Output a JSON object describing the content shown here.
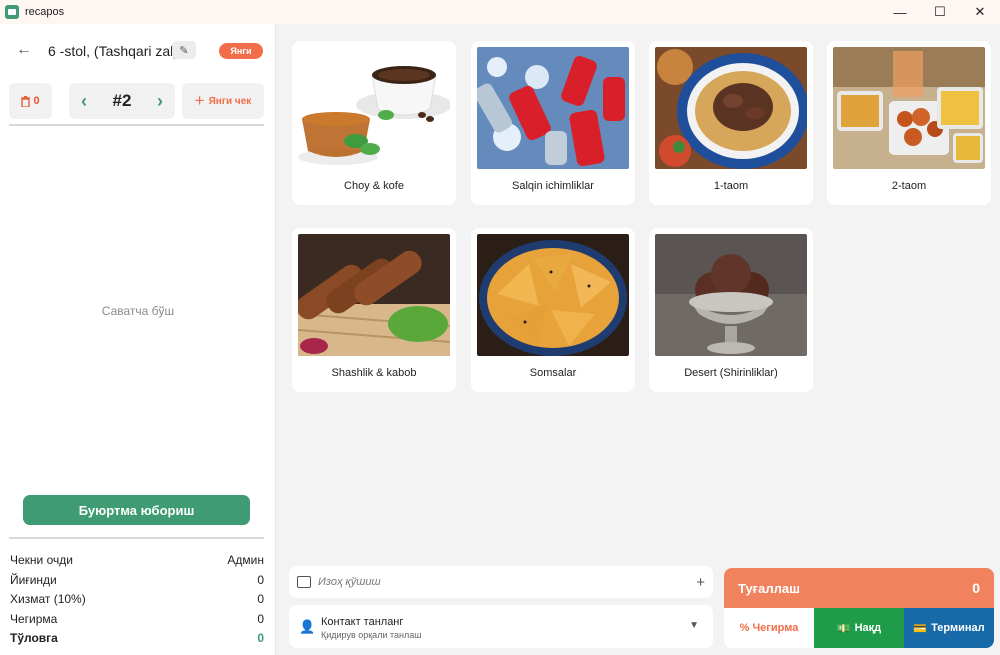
{
  "window": {
    "title": "recapos",
    "minimize": "—",
    "maximize": "☐",
    "close": "✕"
  },
  "order": {
    "table_name": "6 -stol, (Tashqari zal)",
    "status_badge": "Янги",
    "trash_count": "0",
    "check_number": "#2",
    "new_check_label": "Янги чек",
    "cart_empty": "Саватча бўш",
    "send_label": "Буюртма юбориш"
  },
  "summary": [
    {
      "label": "Чекни очди",
      "value": "Админ"
    },
    {
      "label": "Йиғинди",
      "value": "0"
    },
    {
      "label": "Хизмат (10%)",
      "value": "0"
    },
    {
      "label": "Чегирма",
      "value": "0"
    }
  ],
  "summary_total": {
    "label": "Тўловга",
    "value": "0"
  },
  "categories": [
    {
      "label": "Choy & kofe"
    },
    {
      "label": "Salqin ichimliklar"
    },
    {
      "label": "1-taom"
    },
    {
      "label": "2-taom"
    },
    {
      "label": "Shashlik & kabob"
    },
    {
      "label": "Somsalar"
    },
    {
      "label": "Desert (Shirinliklar)"
    }
  ],
  "note": {
    "placeholder": "Изоҳ қўшиш"
  },
  "contact": {
    "title": "Контакт танланг",
    "subtitle": "Қидирув орқали танлаш"
  },
  "payment": {
    "title": "Туғаллаш",
    "total": "0",
    "discount_label": "Чегирма",
    "cash_label": "Нақд",
    "terminal_label": "Терминал"
  },
  "colors": {
    "accent": "#3f9b74",
    "orange": "#f26d4a",
    "cash": "#1e9c4a",
    "terminal": "#1769a8"
  }
}
